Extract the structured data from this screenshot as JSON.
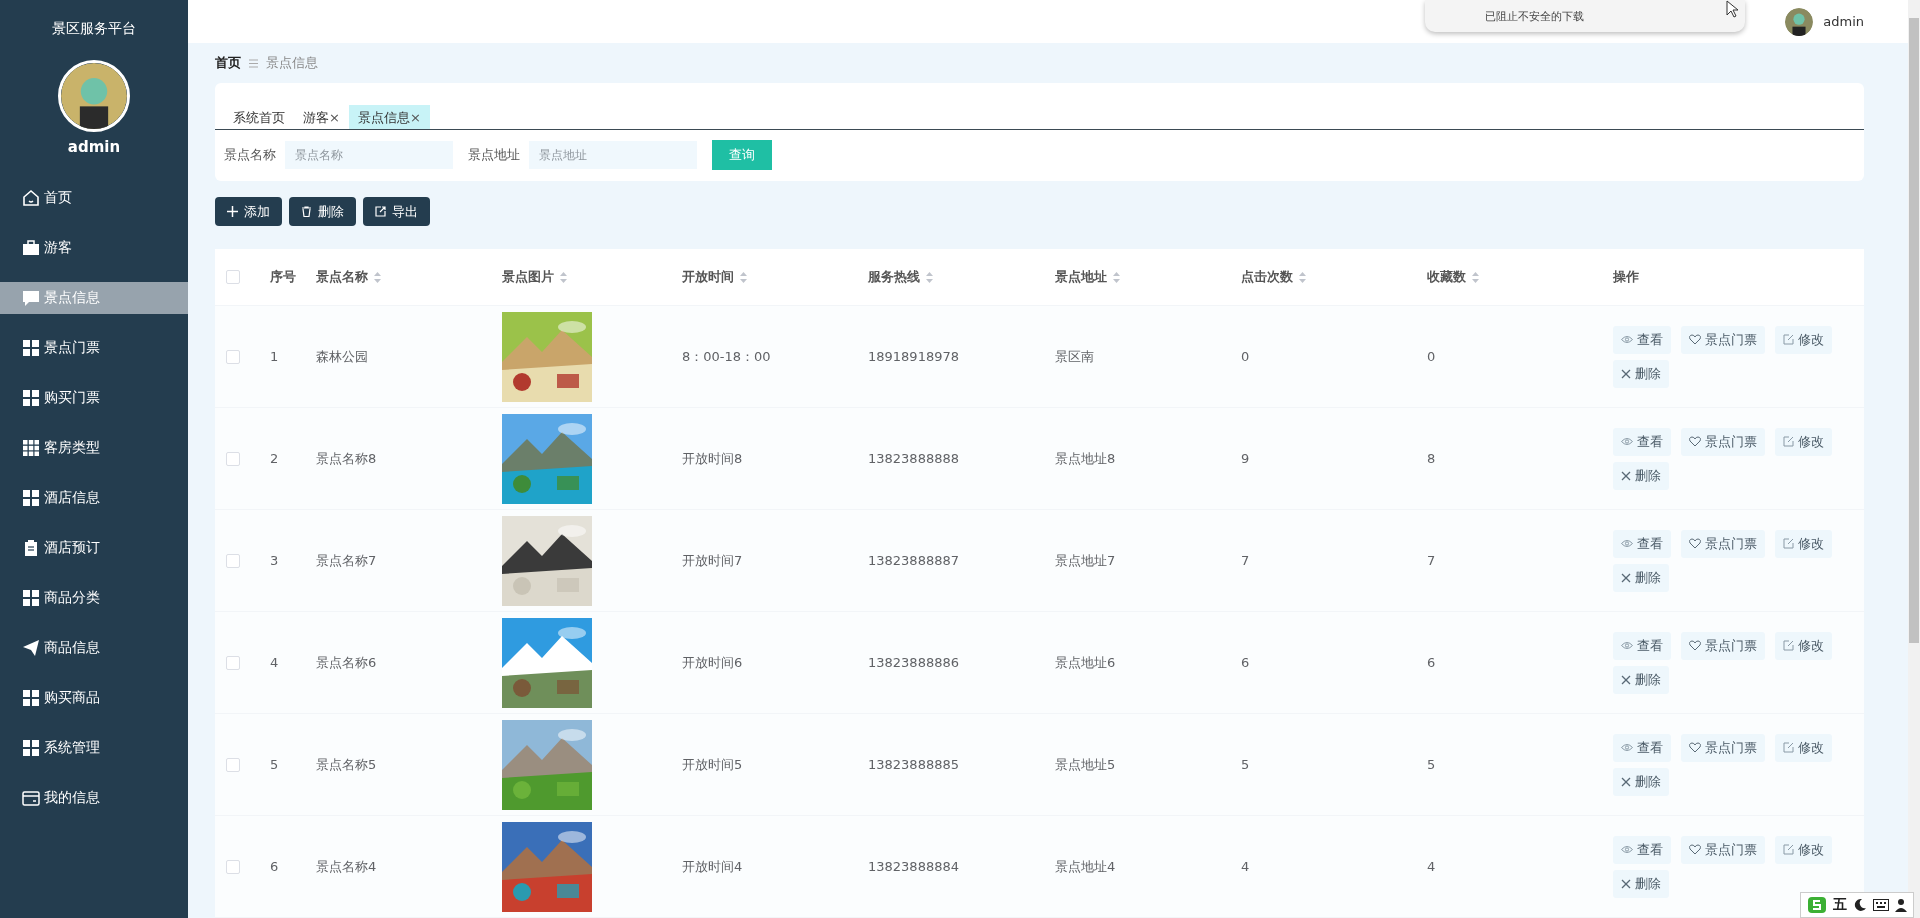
{
  "sidebar": {
    "title": "景区服务平台",
    "user": "admin",
    "items": [
      {
        "label": "首页",
        "selected": false
      },
      {
        "label": "游客",
        "selected": false
      },
      {
        "label": "景点信息",
        "selected": true
      },
      {
        "label": "景点门票",
        "selected": false
      },
      {
        "label": "购买门票",
        "selected": false
      },
      {
        "label": "客房类型",
        "selected": false
      },
      {
        "label": "酒店信息",
        "selected": false
      },
      {
        "label": "酒店预订",
        "selected": false
      },
      {
        "label": "商品分类",
        "selected": false
      },
      {
        "label": "商品信息",
        "selected": false
      },
      {
        "label": "购买商品",
        "selected": false
      },
      {
        "label": "系统管理",
        "selected": false
      },
      {
        "label": "我的信息",
        "selected": false
      }
    ]
  },
  "header": {
    "user": "admin",
    "download_notice": "已阻止不安全的下载"
  },
  "breadcrumb": [
    "首页",
    "景点信息"
  ],
  "tabs": [
    {
      "label": "系统首页",
      "selected": false
    },
    {
      "label": "游客",
      "close": "×",
      "selected": false
    },
    {
      "label": "景点信息",
      "close": "×",
      "selected": true
    }
  ],
  "search": {
    "fields": [
      {
        "label": "景点名称",
        "placeholder": "景点名称"
      },
      {
        "label": "景点地址",
        "placeholder": "景点地址"
      }
    ],
    "button": "查询"
  },
  "toolbar": [
    "添加",
    "删除",
    "导出"
  ],
  "table": {
    "select_all": {
      "checked": false
    },
    "columns": [
      {
        "label": "序号",
        "sortable": false
      },
      {
        "label": "景点名称",
        "sortable": true
      },
      {
        "label": "景点图片",
        "sortable": true
      },
      {
        "label": "开放时间",
        "sortable": true
      },
      {
        "label": "服务热线",
        "sortable": true
      },
      {
        "label": "景点地址",
        "sortable": true
      },
      {
        "label": "点击次数",
        "sortable": true
      },
      {
        "label": "收藏数",
        "sortable": true
      },
      {
        "label": "操作",
        "sortable": false
      }
    ],
    "rows": [
      {
        "checked": false,
        "cells": [
          "1",
          "森林公园",
          {
            "kind": "picture"
          },
          "8：00-18：00",
          "18918918978",
          "景区南",
          "0",
          "0",
          {
            "actions": [
              "查看",
              "景点门票",
              "修改",
              "删除"
            ]
          }
        ]
      },
      {
        "checked": false,
        "cells": [
          "2",
          "景点名称8",
          {
            "kind": "picture"
          },
          "开放时间8",
          "13823888888",
          "景点地址8",
          "9",
          "8",
          {
            "actions": [
              "查看",
              "景点门票",
              "修改",
              "删除"
            ]
          }
        ]
      },
      {
        "checked": false,
        "cells": [
          "3",
          "景点名称7",
          {
            "kind": "picture"
          },
          "开放时间7",
          "13823888887",
          "景点地址7",
          "7",
          "7",
          {
            "actions": [
              "查看",
              "景点门票",
              "修改",
              "删除"
            ]
          }
        ]
      },
      {
        "checked": false,
        "cells": [
          "4",
          "景点名称6",
          {
            "kind": "picture"
          },
          "开放时间6",
          "13823888886",
          "景点地址6",
          "6",
          "6",
          {
            "actions": [
              "查看",
              "景点门票",
              "修改",
              "删除"
            ]
          }
        ]
      },
      {
        "checked": false,
        "cells": [
          "5",
          "景点名称5",
          {
            "kind": "picture"
          },
          "开放时间5",
          "13823888885",
          "景点地址5",
          "5",
          "5",
          {
            "actions": [
              "查看",
              "景点门票",
              "修改",
              "删除"
            ]
          }
        ]
      },
      {
        "checked": false,
        "cells": [
          "6",
          "景点名称4",
          {
            "kind": "picture"
          },
          "开放时间4",
          "13823888884",
          "景点地址4",
          "4",
          "4",
          {
            "actions": [
              "查看",
              "景点门票",
              "修改",
              "删除"
            ]
          }
        ]
      }
    ]
  },
  "ime_toolbar": {
    "mode": "五"
  }
}
